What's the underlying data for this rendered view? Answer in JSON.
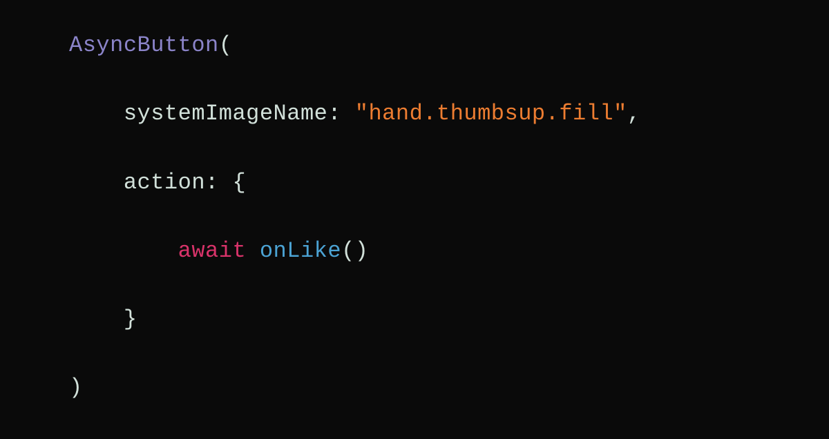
{
  "code": {
    "line1": {
      "type_name": "AsyncButton",
      "paren_open": "("
    },
    "line2": {
      "indent": "    ",
      "param_name": "systemImageName: ",
      "string_value": "\"hand.thumbsup.fill\"",
      "trail": ","
    },
    "line3": {
      "indent": "    ",
      "param_name": "action: {",
      "trail": ""
    },
    "line4": {
      "indent": "        ",
      "keyword": "await",
      "space": " ",
      "func_name": "onLike",
      "call_suffix": "()"
    },
    "line5": {
      "indent": "    ",
      "brace_close": "}"
    },
    "line6": {
      "paren_close": ")"
    }
  }
}
